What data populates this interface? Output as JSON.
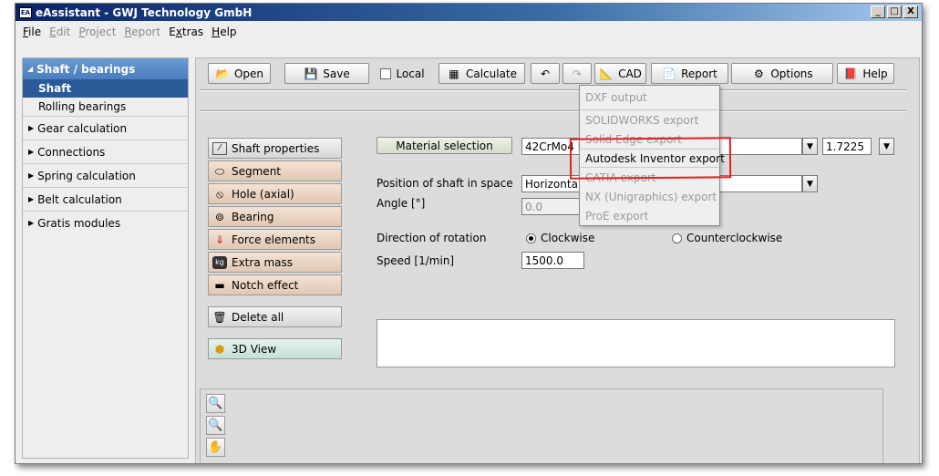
{
  "window": {
    "title": "eAssistant - GWJ Technology GmbH",
    "icon_text": "EA",
    "minimize": "_",
    "maximize": "□",
    "close": "X"
  },
  "menubar": [
    {
      "label": "File",
      "enabled": true
    },
    {
      "label": "Edit",
      "enabled": false
    },
    {
      "label": "Project",
      "enabled": false
    },
    {
      "label": "Report",
      "enabled": false
    },
    {
      "label": "Extras",
      "enabled": true
    },
    {
      "label": "Help",
      "enabled": true
    }
  ],
  "sidebar": {
    "header": "Shaft / bearings",
    "subitems": [
      {
        "label": "Shaft",
        "active": true
      },
      {
        "label": "Rolling bearings",
        "active": false
      }
    ],
    "categories": [
      "Gear calculation",
      "Connections",
      "Spring calculation",
      "Belt calculation",
      "Gratis modules"
    ]
  },
  "toolbar": {
    "open": "Open",
    "save": "Save",
    "local": "Local",
    "calculate": "Calculate",
    "undo_icon": "undo-icon",
    "redo_icon": "redo-icon",
    "cad": "CAD",
    "report": "Report",
    "options": "Options",
    "help": "Help"
  },
  "left_buttons": {
    "shaft_properties": "Shaft properties",
    "segment": "Segment",
    "hole_axial": "Hole (axial)",
    "bearing": "Bearing",
    "force_elements": "Force elements",
    "extra_mass": "Extra mass",
    "notch_effect": "Notch effect",
    "delete_all": "Delete all",
    "view_3d": "3D View"
  },
  "form": {
    "material_selection_button": "Material selection",
    "material_value": "42CrMo4 hardened",
    "density_value": "1.7225",
    "position_label": "Position of shaft in space",
    "position_value": "Horizontal",
    "angle_label": "Angle [°]",
    "angle_value": "0.0",
    "rotation_label": "Direction of rotation",
    "clockwise": "Clockwise",
    "counterclockwise": "Counterclockwise",
    "rotation_selected": "Clockwise",
    "speed_label": "Speed [1/min]",
    "speed_value": "1500.0"
  },
  "cad_menu": {
    "items": [
      {
        "label": "DXF output",
        "enabled": false
      },
      {
        "label": "SOLIDWORKS export",
        "enabled": false
      },
      {
        "label": "Solid Edge export",
        "enabled": false
      },
      {
        "label": "Autodesk Inventor export",
        "enabled": true
      },
      {
        "label": "CATIA export",
        "enabled": false
      },
      {
        "label": "NX (Unigraphics) export",
        "enabled": false
      },
      {
        "label": "ProE export",
        "enabled": false
      }
    ],
    "highlight_color": "#e02020"
  },
  "view_tools": [
    "zoom-in-icon",
    "zoom-icon",
    "pan-hand-icon"
  ]
}
